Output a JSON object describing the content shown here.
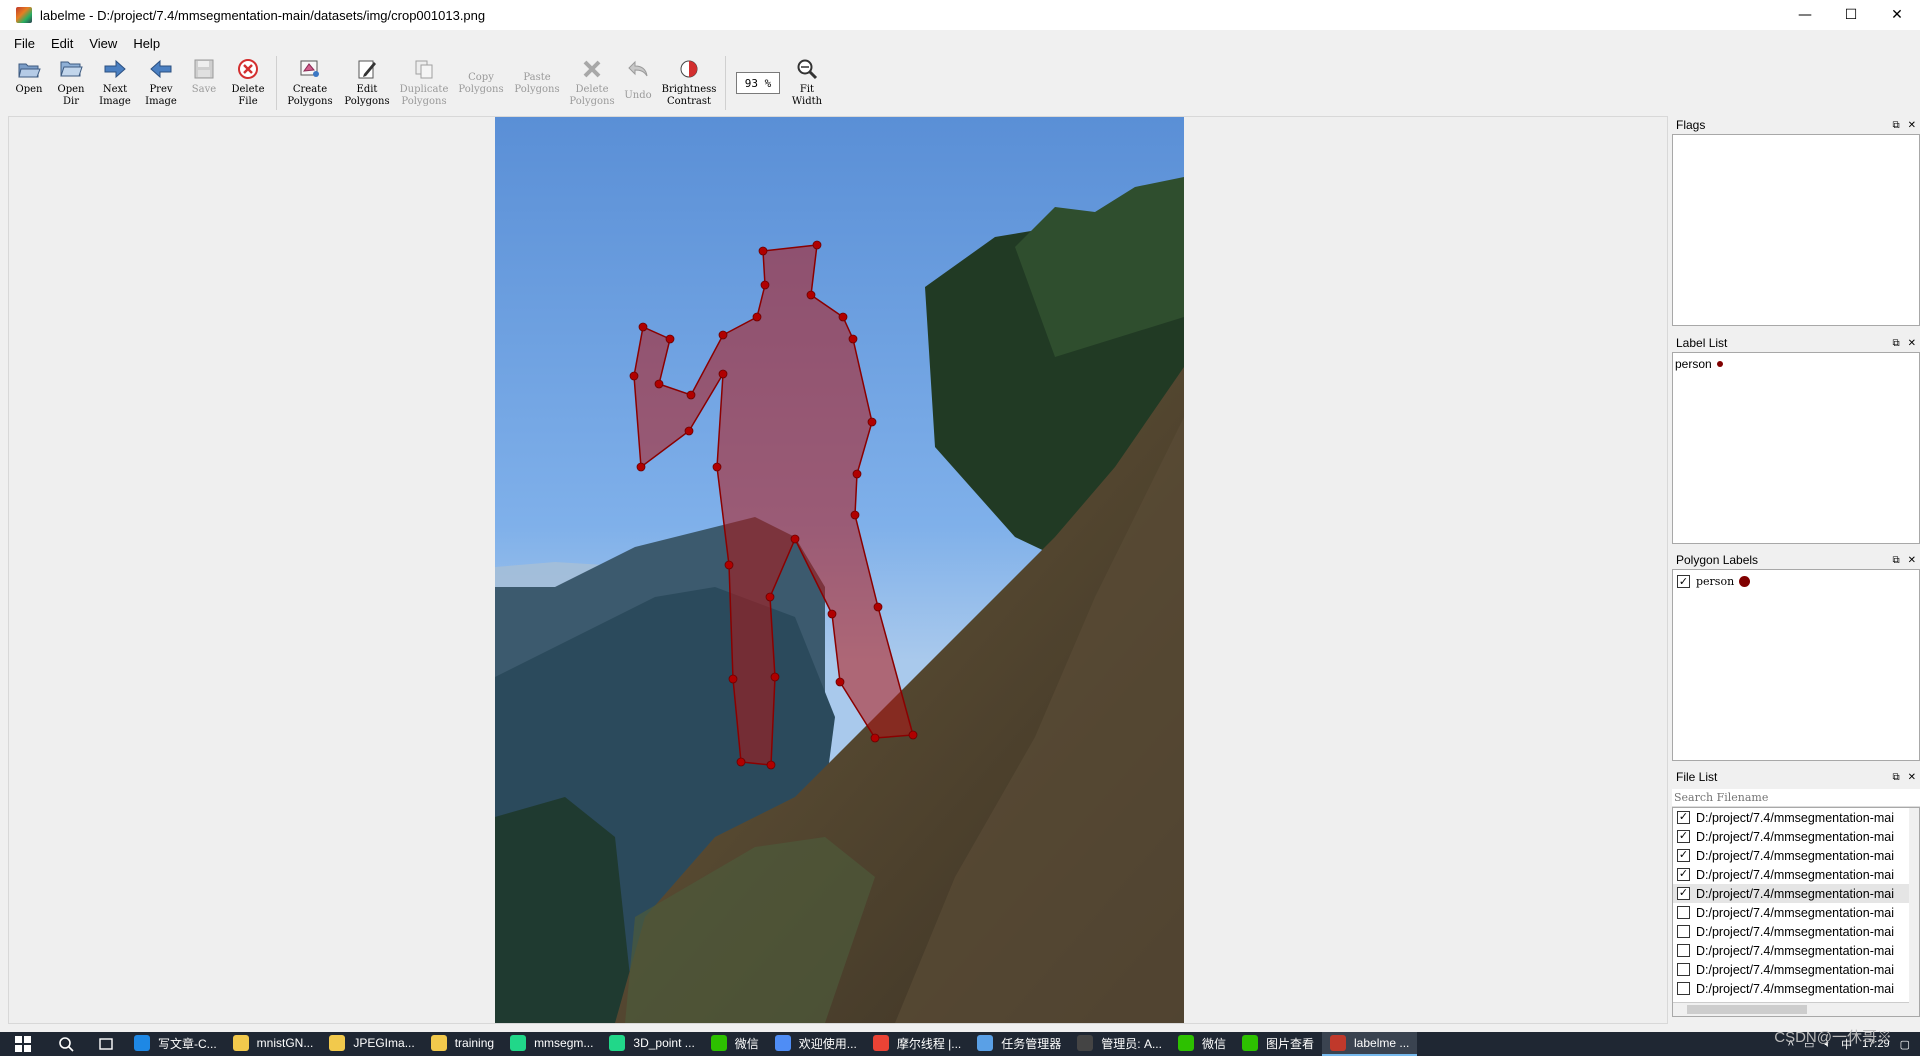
{
  "window": {
    "title": "labelme - D:/project/7.4/mmsegmentation-main/datasets/img/crop001013.png",
    "minimize": "—",
    "maximize": "☐",
    "close": "✕"
  },
  "menu": [
    {
      "label": "File"
    },
    {
      "label": "Edit"
    },
    {
      "label": "View"
    },
    {
      "label": "Help"
    }
  ],
  "toolbar": {
    "open": "Open",
    "open_dir": "Open\nDir",
    "next_image": "Next\nImage",
    "prev_image": "Prev\nImage",
    "save": "Save",
    "delete_file": "Delete\nFile",
    "create_polygons": "Create\nPolygons",
    "edit_polygons": "Edit\nPolygons",
    "duplicate_polygons": "Duplicate\nPolygons",
    "copy_polygons": "Copy\nPolygons",
    "paste_polygons": "Paste\nPolygons",
    "delete_polygons": "Delete\nPolygons",
    "undo": "Undo",
    "brightness_contrast": "Brightness\nContrast",
    "zoom_value": "93 %",
    "fit_width": "Fit\nWidth"
  },
  "docks": {
    "flags": {
      "title": "Flags"
    },
    "label_list": {
      "title": "Label List",
      "items": [
        {
          "label": "person",
          "color": "#800000"
        }
      ]
    },
    "polygon_labels": {
      "title": "Polygon Labels",
      "items": [
        {
          "label": "person",
          "checked": true,
          "color": "#800000"
        }
      ]
    },
    "file_list": {
      "title": "File List",
      "search_placeholder": "Search Filename",
      "items": [
        {
          "path": "D:/project/7.4/mmsegmentation-mai",
          "checked": true
        },
        {
          "path": "D:/project/7.4/mmsegmentation-mai",
          "checked": true
        },
        {
          "path": "D:/project/7.4/mmsegmentation-mai",
          "checked": true
        },
        {
          "path": "D:/project/7.4/mmsegmentation-mai",
          "checked": true
        },
        {
          "path": "D:/project/7.4/mmsegmentation-mai",
          "checked": true,
          "selected": true
        },
        {
          "path": "D:/project/7.4/mmsegmentation-mai",
          "checked": false
        },
        {
          "path": "D:/project/7.4/mmsegmentation-mai",
          "checked": false
        },
        {
          "path": "D:/project/7.4/mmsegmentation-mai",
          "checked": false
        },
        {
          "path": "D:/project/7.4/mmsegmentation-mai",
          "checked": false
        },
        {
          "path": "D:/project/7.4/mmsegmentation-mai",
          "checked": false
        }
      ]
    }
  },
  "taskbar": {
    "items": [
      {
        "label": "写文章-C...",
        "color": "#1e88e5"
      },
      {
        "label": "mnistGN...",
        "color": "#f2c94c"
      },
      {
        "label": "JPEGIma...",
        "color": "#f2c94c"
      },
      {
        "label": "training",
        "color": "#f2c94c"
      },
      {
        "label": "mmsegm...",
        "color": "#21d789"
      },
      {
        "label": "3D_point ...",
        "color": "#21d789"
      },
      {
        "label": "微信",
        "color": "#2dc100"
      },
      {
        "label": "欢迎使用...",
        "color": "#4f8df5"
      },
      {
        "label": "摩尔线程 |...",
        "color": "#ea4335"
      },
      {
        "label": "任务管理器",
        "color": "#5aa0e6"
      },
      {
        "label": "管理员: A...",
        "color": "#444"
      },
      {
        "label": "微信",
        "color": "#2dc100"
      },
      {
        "label": "图片查看",
        "color": "#2dc100"
      },
      {
        "label": "labelme ...",
        "color": "#c0392b",
        "active": true
      }
    ],
    "tray_ime": "中",
    "tray_time": "17:29"
  },
  "watermark": "CSDN@一休哥※"
}
